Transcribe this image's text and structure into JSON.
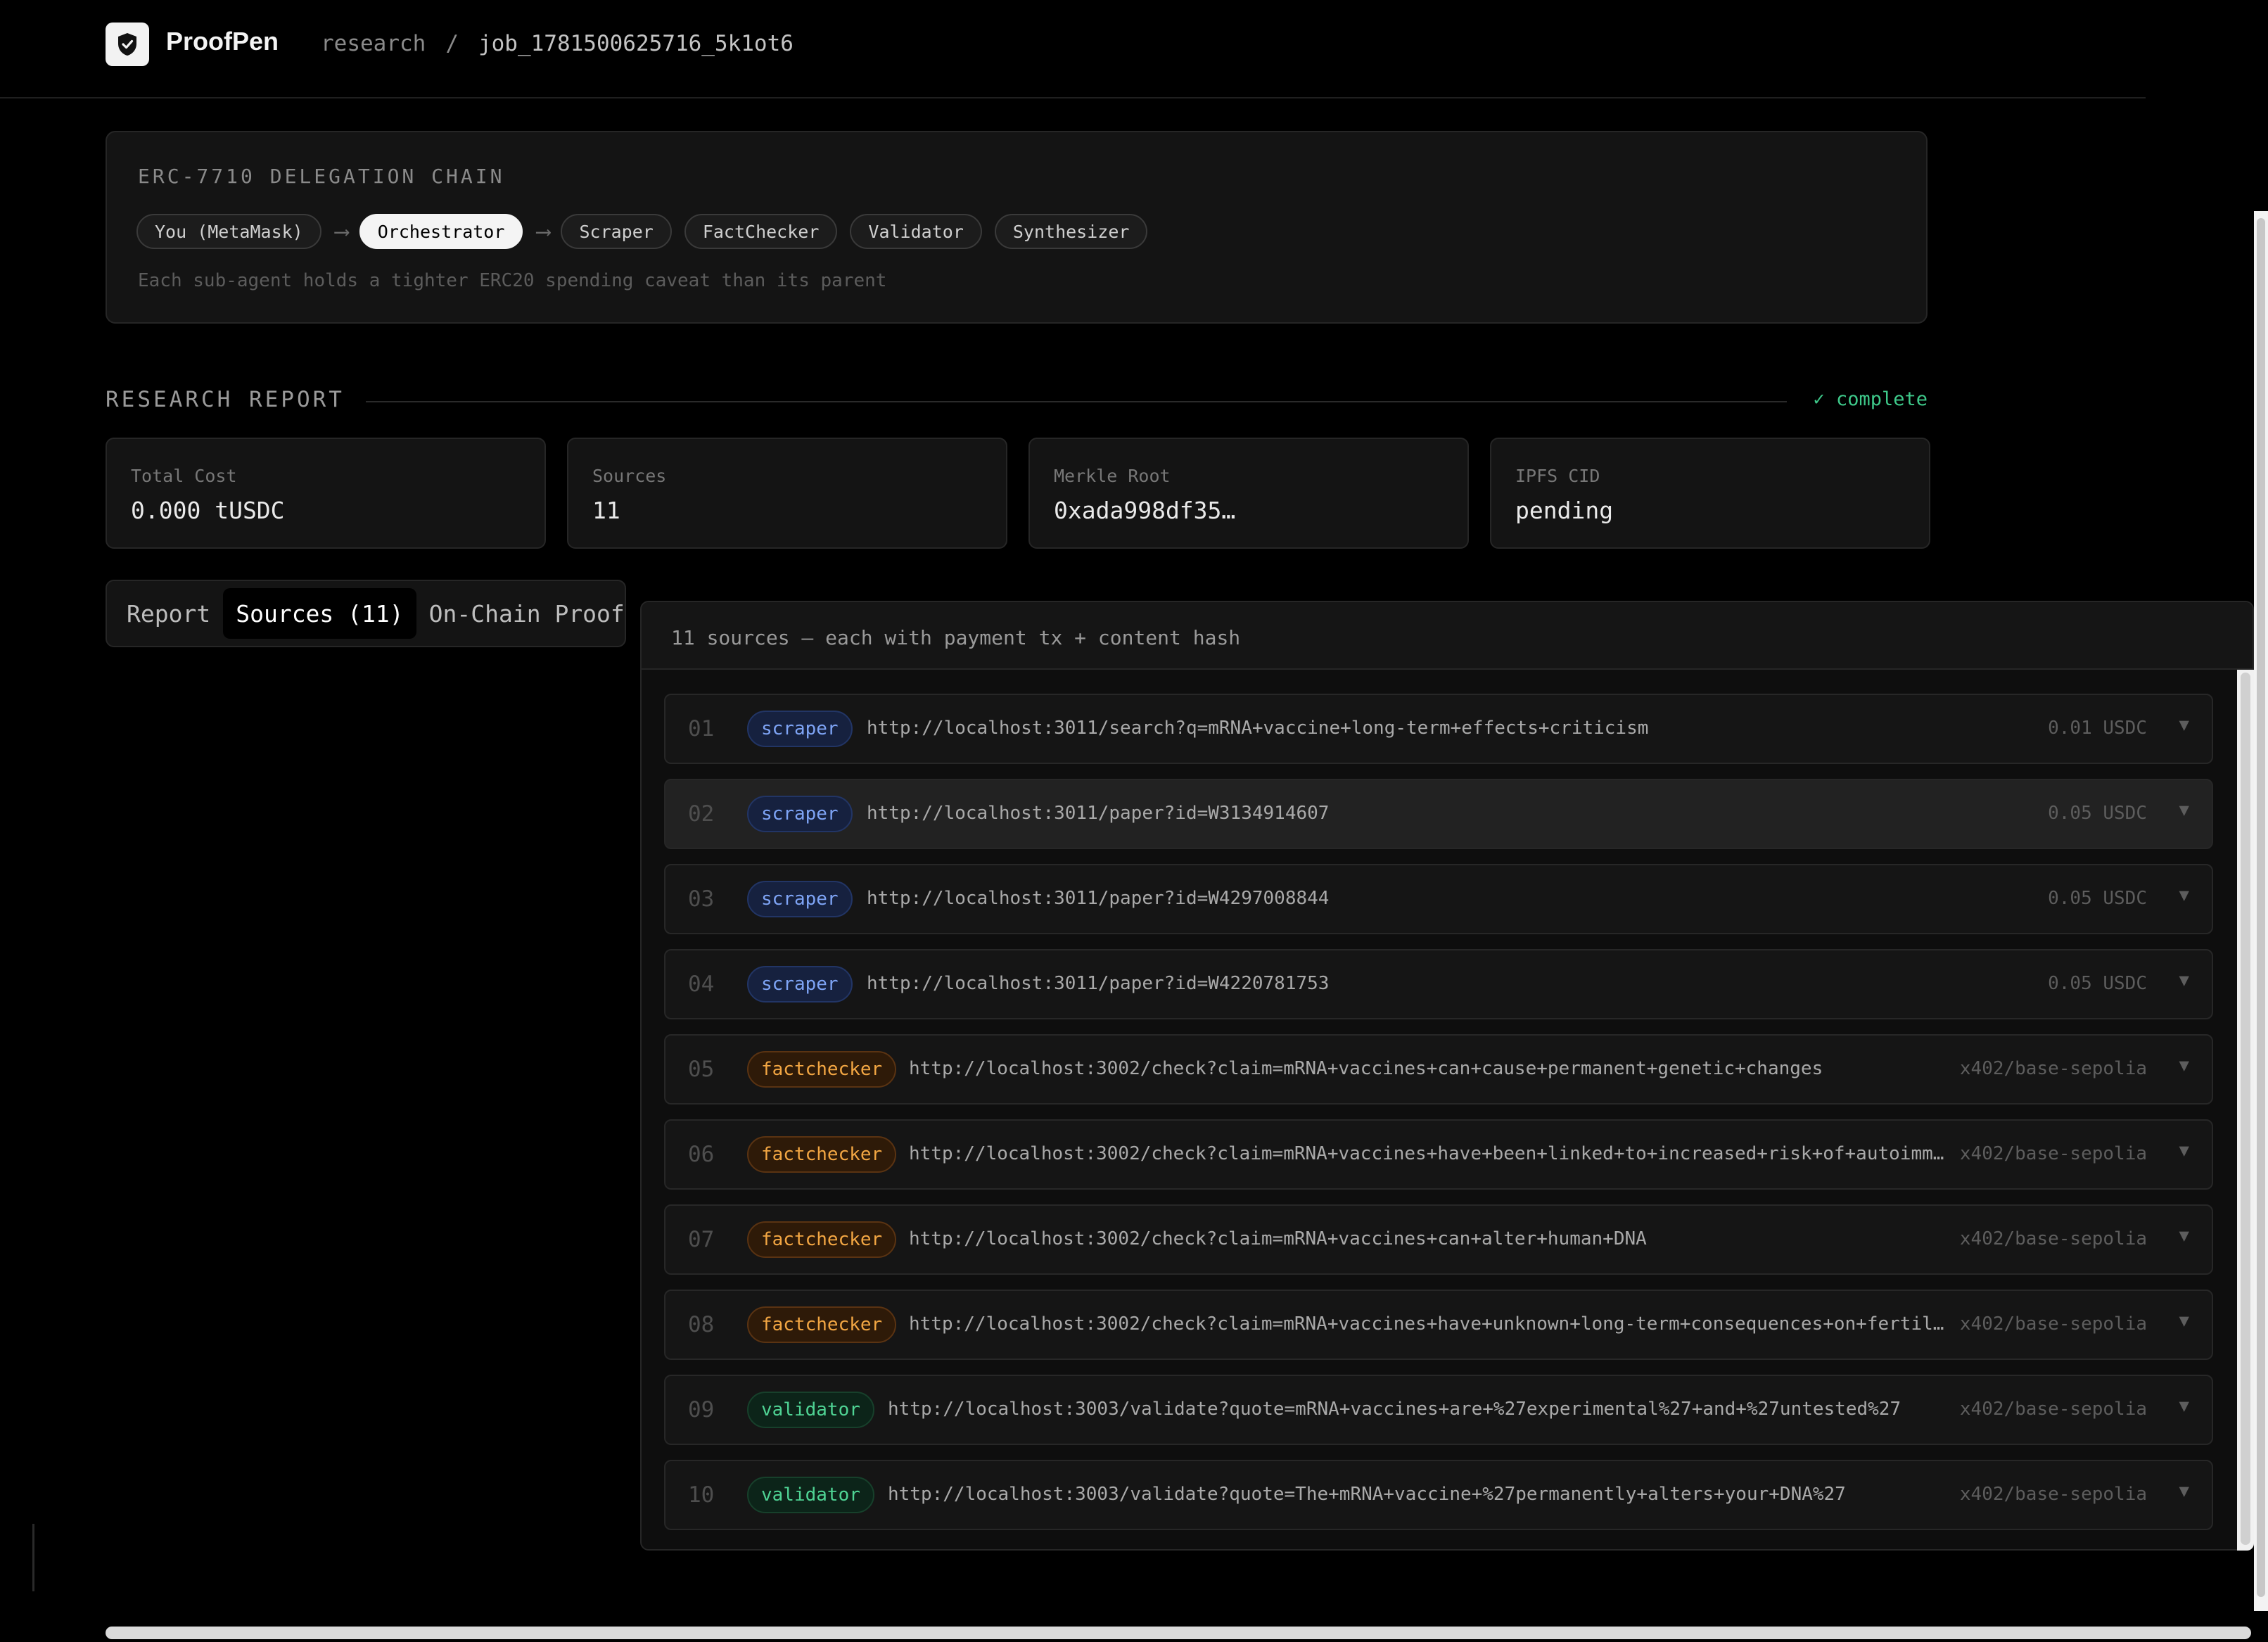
{
  "header": {
    "brand": "ProofPen",
    "breadcrumb": {
      "section": "research",
      "separator": "/",
      "job_id": "job_1781500625716_5k1ot6"
    }
  },
  "delegation": {
    "title": "ERC-7710 DELEGATION CHAIN",
    "chain": [
      "You (MetaMask)",
      "Orchestrator",
      "Scraper",
      "FactChecker",
      "Validator",
      "Synthesizer"
    ],
    "active_index": 1,
    "note": "Each sub-agent holds a tighter ERC20 spending caveat than its parent"
  },
  "report": {
    "title": "RESEARCH REPORT",
    "status": "✓ complete",
    "stats": [
      {
        "label": "Total Cost",
        "value": "0.000 tUSDC"
      },
      {
        "label": "Sources",
        "value": "11"
      },
      {
        "label": "Merkle Root",
        "value": "0xada998df35…"
      },
      {
        "label": "IPFS CID",
        "value": "pending"
      }
    ]
  },
  "tabs": [
    {
      "label": "Report",
      "active": false
    },
    {
      "label": "Sources (11)",
      "active": true
    },
    {
      "label": "On-Chain Proof",
      "active": false
    }
  ],
  "sources_panel": {
    "header": "11 sources — each with payment tx + content hash",
    "rows": [
      {
        "index": "01",
        "agent": "scraper",
        "url": "http://localhost:3011/search?q=mRNA+vaccine+long-term+effects+criticism",
        "payment": "0.01 USDC"
      },
      {
        "index": "02",
        "agent": "scraper",
        "url": "http://localhost:3011/paper?id=W3134914607",
        "payment": "0.05 USDC",
        "highlighted": true
      },
      {
        "index": "03",
        "agent": "scraper",
        "url": "http://localhost:3011/paper?id=W4297008844",
        "payment": "0.05 USDC"
      },
      {
        "index": "04",
        "agent": "scraper",
        "url": "http://localhost:3011/paper?id=W4220781753",
        "payment": "0.05 USDC"
      },
      {
        "index": "05",
        "agent": "factchecker",
        "url": "http://localhost:3002/check?claim=mRNA+vaccines+can+cause+permanent+genetic+changes",
        "payment": "x402/base-sepolia"
      },
      {
        "index": "06",
        "agent": "factchecker",
        "url": "http://localhost:3002/check?claim=mRNA+vaccines+have+been+linked+to+increased+risk+of+autoimmune+diseases",
        "payment": "x402/base-sepolia"
      },
      {
        "index": "07",
        "agent": "factchecker",
        "url": "http://localhost:3002/check?claim=mRNA+vaccines+can+alter+human+DNA",
        "payment": "x402/base-sepolia"
      },
      {
        "index": "08",
        "agent": "factchecker",
        "url": "http://localhost:3002/check?claim=mRNA+vaccines+have+unknown+long-term+consequences+on+fertility",
        "payment": "x402/base-sepolia"
      },
      {
        "index": "09",
        "agent": "validator",
        "url": "http://localhost:3003/validate?quote=mRNA+vaccines+are+%27experimental%27+and+%27untested%27",
        "payment": "x402/base-sepolia"
      },
      {
        "index": "10",
        "agent": "validator",
        "url": "http://localhost:3003/validate?quote=The+mRNA+vaccine+%27permanently+alters+your+DNA%27",
        "payment": "x402/base-sepolia"
      }
    ]
  },
  "icons": {
    "logo": "shield-check-icon",
    "expand": "chevron-down-icon"
  },
  "colors": {
    "scraper": "#7ea4f5",
    "factchecker": "#f2a643",
    "validator": "#4fd394",
    "complete": "#3ec98a"
  }
}
